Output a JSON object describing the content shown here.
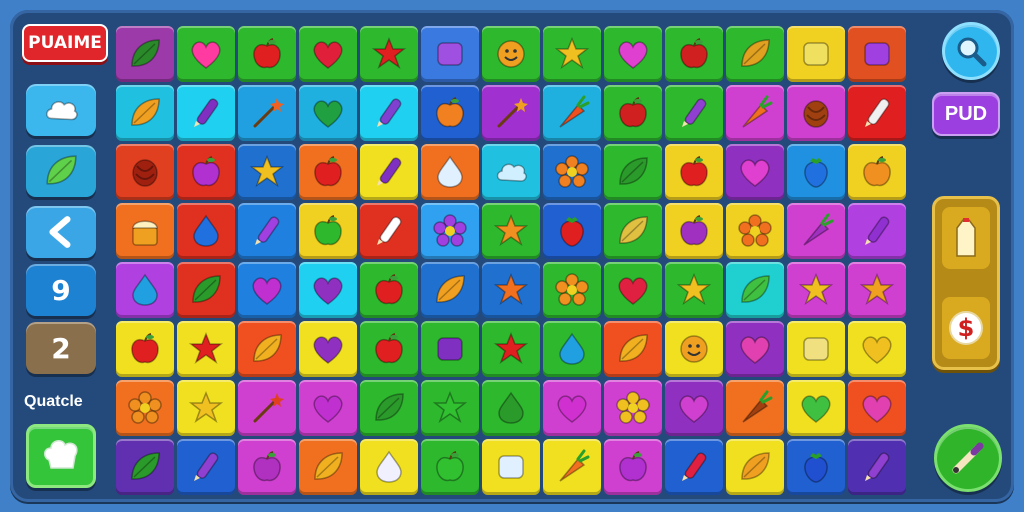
{
  "header": {
    "logo_text": "PUAIME"
  },
  "sidebar": {
    "buttons": [
      {
        "icon": "cloud-icon",
        "color": "#3bb7ee",
        "text": ""
      },
      {
        "icon": "leaf-icon",
        "color": "#2aa5d8",
        "text": ""
      },
      {
        "icon": "chevron-left-icon",
        "color": "#3aa6e6",
        "text": ""
      },
      {
        "icon": "number",
        "color": "#1e82d2",
        "text": "9"
      },
      {
        "icon": "number",
        "color": "#8a6f4c",
        "text": "2"
      }
    ],
    "label": "Quatcle",
    "bottom_button_icon": "chef-hat-icon"
  },
  "right_panel": {
    "pud_label": "PUD",
    "search_icon": "search-icon",
    "slot_icons": [
      "milk-carton-icon",
      "dollar-icon"
    ],
    "bottom_button_icon": "pen-icon"
  },
  "board": {
    "rows": [
      [
        [
          "#9b3aa8",
          "leaf",
          "#2a8a2a"
        ],
        [
          "#2eb82e",
          "heart",
          "#ff3aa0"
        ],
        [
          "#2eb82e",
          "apple",
          "#e02020"
        ],
        [
          "#2eb82e",
          "heart",
          "#e0203a"
        ],
        [
          "#2eb82e",
          "star",
          "#e02020"
        ],
        [
          "#3a7ae0",
          "box",
          "#a050e0"
        ],
        [
          "#2eb82e",
          "face",
          "#f0a020"
        ],
        [
          "#2eb82e",
          "star",
          "#f0c020"
        ],
        [
          "#2eb82e",
          "heart",
          "#e040d0"
        ],
        [
          "#2eb82e",
          "apple",
          "#d02020"
        ],
        [
          "#2eb82e",
          "leaf",
          "#e0a020"
        ],
        [
          "#f0d020",
          "box",
          "#f0e060"
        ],
        [
          "#e05020",
          "box",
          "#a040e0"
        ]
      ],
      [
        [
          "#20c0e0",
          "leaf",
          "#f0a020"
        ],
        [
          "#20d0f0",
          "pen",
          "#8030c0"
        ],
        [
          "#20a0e0",
          "wand",
          "#f06020"
        ],
        [
          "#20b0e0",
          "heart",
          "#20a040"
        ],
        [
          "#20d0f0",
          "pen",
          "#8040d0"
        ],
        [
          "#2060d0",
          "apple",
          "#f08020"
        ],
        [
          "#a030d0",
          "wand",
          "#f0a020"
        ],
        [
          "#20b0e0",
          "carrot",
          "#f05020"
        ],
        [
          "#2eb82e",
          "apple",
          "#d02020"
        ],
        [
          "#2eb82e",
          "pen",
          "#9040d0"
        ],
        [
          "#d040d0",
          "carrot",
          "#f07020"
        ],
        [
          "#d040d0",
          "nut",
          "#a04010"
        ],
        [
          "#e02020",
          "pen",
          "#f0f0f0"
        ]
      ],
      [
        [
          "#e04020",
          "nut",
          "#a02010"
        ],
        [
          "#e03020",
          "apple",
          "#b030d0"
        ],
        [
          "#2070d0",
          "star",
          "#f0c020"
        ],
        [
          "#f07020",
          "apple",
          "#e02020"
        ],
        [
          "#f0e020",
          "pen",
          "#8030c0"
        ],
        [
          "#f07020",
          "drop",
          "#e0f0ff"
        ],
        [
          "#20c0e0",
          "cloud",
          "#d0f0ff"
        ],
        [
          "#2070d0",
          "flower",
          "#f08020"
        ],
        [
          "#2eb82e",
          "leaf",
          "#2a9a2a"
        ],
        [
          "#f0d020",
          "apple",
          "#e02020"
        ],
        [
          "#9030c0",
          "heart",
          "#e040d0"
        ],
        [
          "#2090e0",
          "berry",
          "#2070e0"
        ],
        [
          "#f0d020",
          "apple",
          "#f09020"
        ]
      ],
      [
        [
          "#f07020",
          "cake",
          "#f0a020"
        ],
        [
          "#e03020",
          "drop",
          "#2070e0"
        ],
        [
          "#2080e0",
          "pen",
          "#a040e0"
        ],
        [
          "#f0d020",
          "apple",
          "#2eb82e"
        ],
        [
          "#e03020",
          "pen",
          "#ffffff"
        ],
        [
          "#30a0f0",
          "flower",
          "#a040e0"
        ],
        [
          "#2eb82e",
          "star",
          "#f09020"
        ],
        [
          "#2060d0",
          "berry",
          "#e02020"
        ],
        [
          "#2eb82e",
          "leaf",
          "#e0c040"
        ],
        [
          "#f0d020",
          "apple",
          "#a030c0"
        ],
        [
          "#f0d020",
          "flower",
          "#f07020"
        ],
        [
          "#d040d0",
          "carrot",
          "#a030c0"
        ],
        [
          "#b040e0",
          "pen",
          "#9030d0"
        ]
      ],
      [
        [
          "#b040e0",
          "drop",
          "#20a0e0"
        ],
        [
          "#e03020",
          "leaf",
          "#2a9a2a"
        ],
        [
          "#2080e0",
          "heart",
          "#c030d0"
        ],
        [
          "#20d0f0",
          "heart",
          "#9030c0"
        ],
        [
          "#2eb82e",
          "apple",
          "#e02020"
        ],
        [
          "#2070d0",
          "leaf",
          "#f0a020"
        ],
        [
          "#2070d0",
          "star",
          "#f07020"
        ],
        [
          "#2eb82e",
          "flower",
          "#f09020"
        ],
        [
          "#2eb82e",
          "heart",
          "#e02040"
        ],
        [
          "#2eb82e",
          "star",
          "#f0c020"
        ],
        [
          "#20d0d0",
          "leaf",
          "#40c040"
        ],
        [
          "#d040d0",
          "star",
          "#f0c020"
        ],
        [
          "#d040d0",
          "star",
          "#f0a020"
        ]
      ],
      [
        [
          "#f0e020",
          "apple",
          "#e02020"
        ],
        [
          "#f0e020",
          "star",
          "#e02020"
        ],
        [
          "#f05020",
          "leaf",
          "#f0b020"
        ],
        [
          "#f0e020",
          "heart",
          "#9030c0"
        ],
        [
          "#2eb82e",
          "apple",
          "#e02020"
        ],
        [
          "#2eb82e",
          "box",
          "#8030c0"
        ],
        [
          "#2eb82e",
          "star",
          "#e02020"
        ],
        [
          "#2eb82e",
          "drop",
          "#20a0e0"
        ],
        [
          "#f05020",
          "leaf",
          "#f0b020"
        ],
        [
          "#f0e020",
          "face",
          "#f0a020"
        ],
        [
          "#9030c0",
          "heart",
          "#e040b0"
        ],
        [
          "#f0e020",
          "box",
          "#f0e080"
        ],
        [
          "#f0e020",
          "heart",
          "#f0c020"
        ]
      ],
      [
        [
          "#f07020",
          "flower",
          "#f09020"
        ],
        [
          "#f0e020",
          "star",
          "#f0c020"
        ],
        [
          "#d040d0",
          "wand",
          "#e04020"
        ],
        [
          "#d040d0",
          "heart",
          "#c030d0"
        ],
        [
          "#2eb82e",
          "leaf",
          "#2a9a2a"
        ],
        [
          "#2eb82e",
          "star",
          "#30c030"
        ],
        [
          "#2eb82e",
          "drop",
          "#2a9a2a"
        ],
        [
          "#d040d0",
          "heart",
          "#d030d0"
        ],
        [
          "#d040d0",
          "flower",
          "#f0c020"
        ],
        [
          "#9030c0",
          "heart",
          "#d040d0"
        ],
        [
          "#f07020",
          "carrot",
          "#a04010"
        ],
        [
          "#f0e020",
          "heart",
          "#40c040"
        ],
        [
          "#f05020",
          "heart",
          "#e040b0"
        ]
      ],
      [
        [
          "#6030b0",
          "leaf",
          "#2a9a2a"
        ],
        [
          "#2060d0",
          "pen",
          "#9040d0"
        ],
        [
          "#d040d0",
          "apple",
          "#b030c0"
        ],
        [
          "#f07020",
          "leaf",
          "#f0b020"
        ],
        [
          "#f0e020",
          "drop",
          "#f0f0ff"
        ],
        [
          "#2eb82e",
          "apple",
          "#30c030"
        ],
        [
          "#f0e020",
          "box",
          "#e0f0ff"
        ],
        [
          "#f0e020",
          "carrot",
          "#f07020"
        ],
        [
          "#d040d0",
          "apple",
          "#b030d0"
        ],
        [
          "#2060d0",
          "pen",
          "#e02040"
        ],
        [
          "#f0e020",
          "leaf",
          "#f0a020"
        ],
        [
          "#2060d0",
          "berry",
          "#2050d0"
        ],
        [
          "#5030b0",
          "pen",
          "#9040d0"
        ]
      ]
    ]
  },
  "colors": {
    "background": "#3f80c8",
    "frame": "#244a7c",
    "logo": "#e0262a",
    "pud_button": "#9b3fe0",
    "search_button": "#2fb6ee",
    "side_panel": "#b58a16",
    "pen_button": "#2fb42a",
    "bottom_left_button": "#34c53a"
  }
}
